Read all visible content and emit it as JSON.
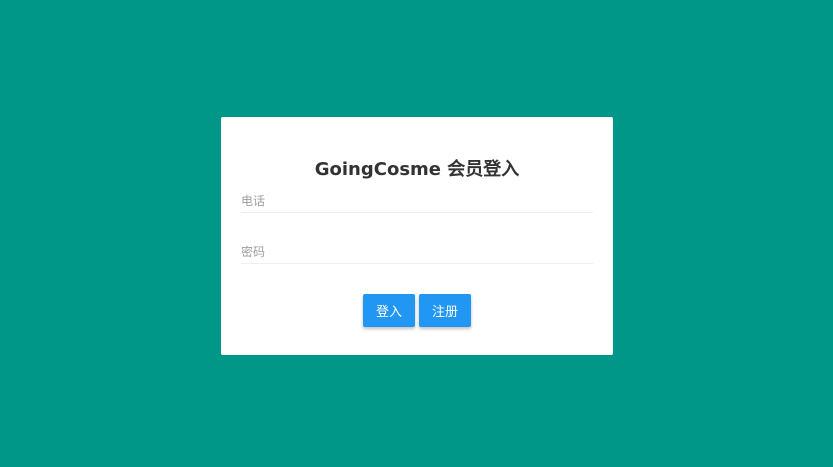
{
  "login": {
    "title": "GoingCosme 会员登入",
    "phone_placeholder": "电话",
    "phone_value": "",
    "password_placeholder": "密码",
    "password_value": "",
    "login_label": "登入",
    "register_label": "注册"
  },
  "colors": {
    "background": "#009688",
    "card": "#ffffff",
    "button": "#2196f3"
  }
}
